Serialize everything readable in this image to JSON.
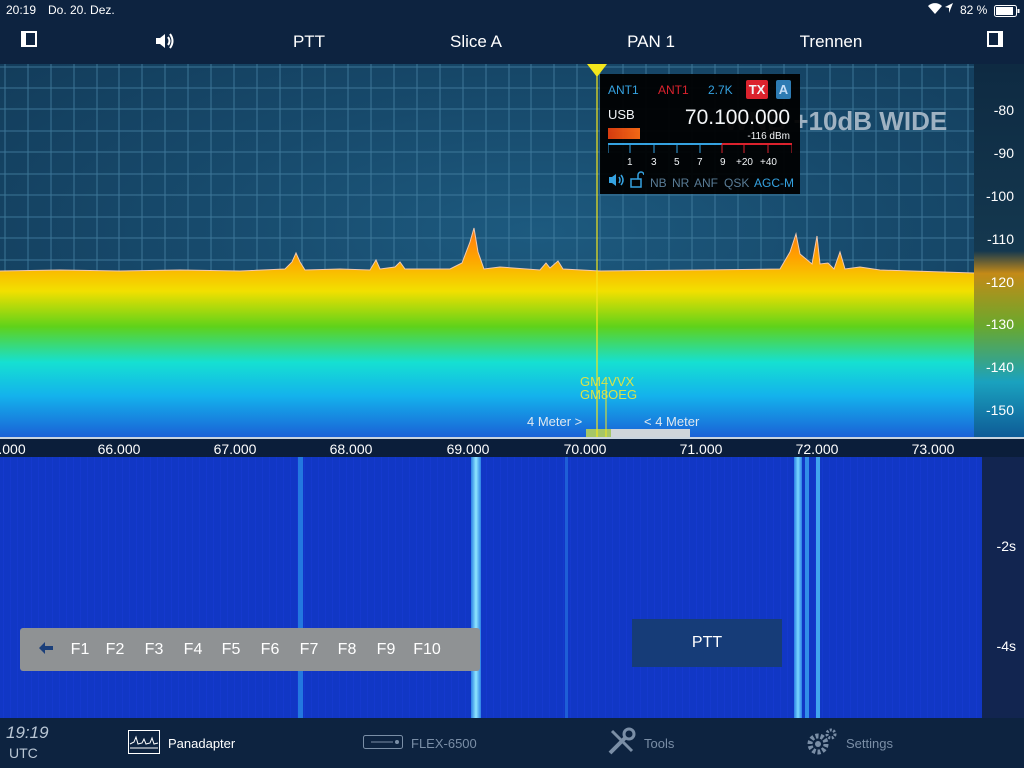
{
  "status": {
    "time": "20:19",
    "date": "Do. 20. Dez.",
    "battery": "82 %"
  },
  "nav": {
    "ptt": "PTT",
    "slice": "Slice A",
    "pan": "PAN 1",
    "disconnect": "Trennen"
  },
  "spectrum": {
    "overlay": "WNB +10dB  WIDE",
    "db_labels": [
      "-80",
      "-90",
      "-100",
      "-110",
      "-120",
      "-130",
      "-140",
      "-150"
    ],
    "freq_labels": [
      ".000",
      "66.000",
      "67.000",
      "68.000",
      "69.000",
      "70.000",
      "71.000",
      "72.000",
      "73.000"
    ],
    "spots": [
      "GM4VVX",
      "GM8OEG"
    ],
    "band_left": "4 Meter >",
    "band_right": "< 4 Meter"
  },
  "slice": {
    "rx_ant": "ANT1",
    "tx_ant": "ANT1",
    "bw": "2.7K",
    "tx_badge": "TX",
    "letter": "A",
    "mode": "USB",
    "freq": "70.100.000",
    "level": "-116 dBm",
    "meter_labels": [
      "1",
      "3",
      "5",
      "7",
      "9",
      "+20",
      "+40"
    ],
    "dsp": [
      "NB",
      "NR",
      "ANF",
      "QSK",
      "AGC-M"
    ]
  },
  "waterfall": {
    "time_labels": [
      "-2s",
      "-4s"
    ]
  },
  "fkeys": {
    "labels": [
      "F1",
      "F2",
      "F3",
      "F4",
      "F5",
      "F6",
      "F7",
      "F8",
      "F9",
      "F10"
    ]
  },
  "ptt_button": "PTT",
  "bottom": {
    "clock": "19:19",
    "tz": "UTC",
    "panadapter": "Panadapter",
    "radio": "FLEX-6500",
    "tools": "Tools",
    "settings": "Settings"
  },
  "colors": {
    "accent_yellow": "#f3e61c",
    "tx_red": "#e8202a",
    "nav_bg": "#0d2340"
  }
}
